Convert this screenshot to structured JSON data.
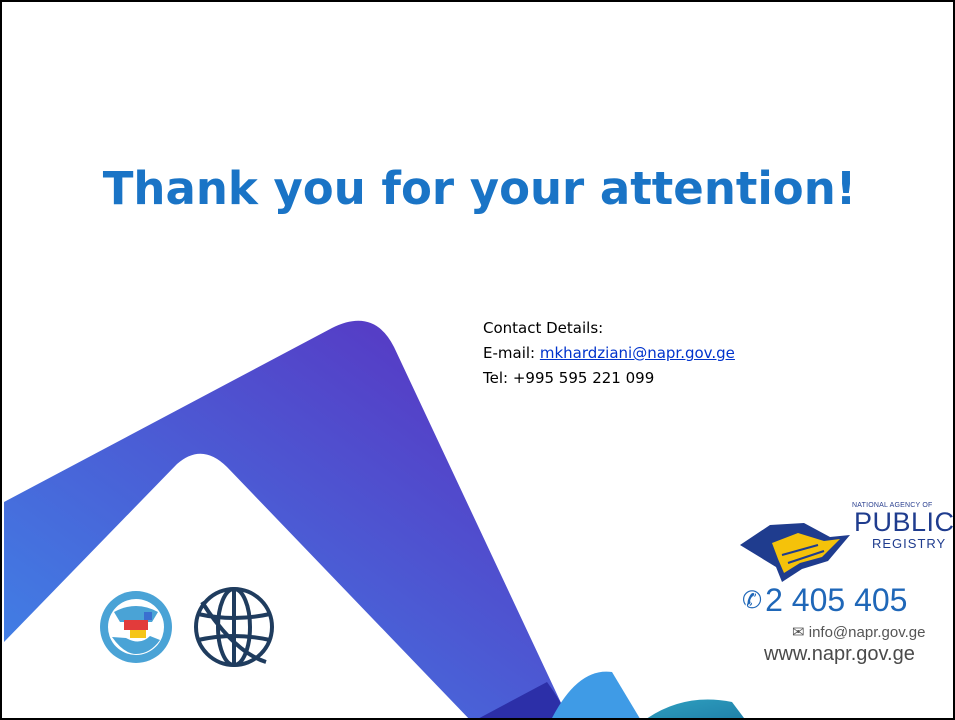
{
  "slide": {
    "title": "Thank you for your attention!",
    "contact": {
      "heading": "Contact Details:",
      "email_label": "E-mail: ",
      "email_value": "mkhardziani@napr.gov.ge",
      "tel_label": "Tel: ",
      "tel_value": "+995 595 221 099"
    },
    "napr_logo": {
      "small_text": "NATIONAL AGENCY OF",
      "public": "PUBLIC",
      "registry": "REGISTRY",
      "phone": "2 405 405",
      "email": "info@napr.gov.ge",
      "website": "www.napr.gov.ge"
    },
    "colors": {
      "title": "#1a74c6",
      "link": "#0033cc",
      "ribbon_blue": "#3a7be0",
      "ribbon_purple": "#5a2fc0",
      "napr_blue": "#1f3c8e",
      "napr_yellow": "#f5c20a"
    },
    "icons": [
      "phone-icon",
      "envelope-icon",
      "geo-logo-icon",
      "world-bank-globe-icon"
    ]
  }
}
